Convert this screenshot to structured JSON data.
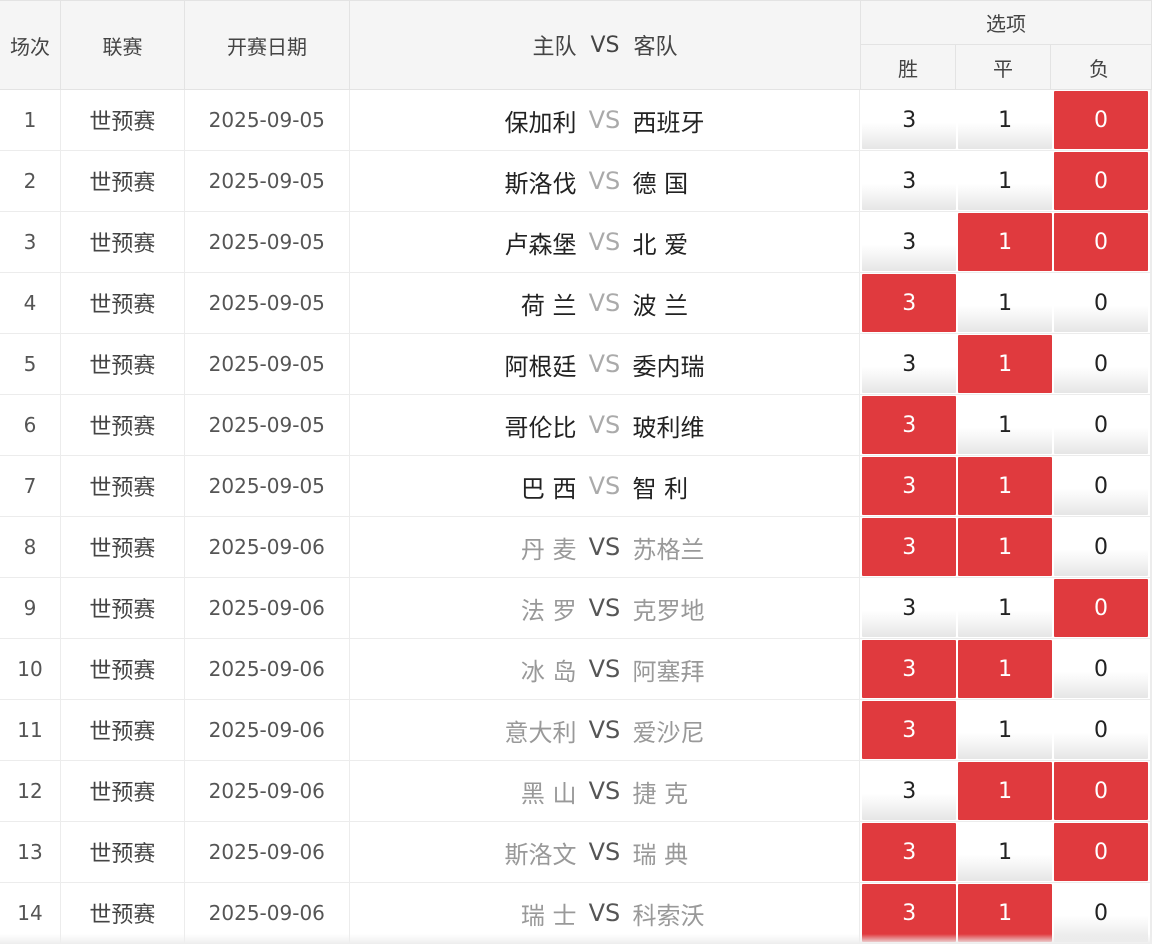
{
  "header": {
    "num": "场次",
    "league": "联赛",
    "date": "开赛日期",
    "home": "主队",
    "vs": "VS",
    "away": "客队",
    "options": "选项",
    "win": "胜",
    "draw": "平",
    "lose": "负"
  },
  "colors": {
    "selected": "#e03a3e",
    "header_bg": "#f5f5f5"
  },
  "rows": [
    {
      "num": "1",
      "league": "世预赛",
      "date": "2025-09-05",
      "home": "保加利",
      "vs": "VS",
      "away": "西班牙",
      "w": "3",
      "d": "1",
      "l": "0",
      "sel": [
        false,
        false,
        true
      ],
      "active": true
    },
    {
      "num": "2",
      "league": "世预赛",
      "date": "2025-09-05",
      "home": "斯洛伐",
      "vs": "VS",
      "away": "德 国",
      "w": "3",
      "d": "1",
      "l": "0",
      "sel": [
        false,
        false,
        true
      ],
      "active": true
    },
    {
      "num": "3",
      "league": "世预赛",
      "date": "2025-09-05",
      "home": "卢森堡",
      "vs": "VS",
      "away": "北 爱",
      "w": "3",
      "d": "1",
      "l": "0",
      "sel": [
        false,
        true,
        true
      ],
      "active": true
    },
    {
      "num": "4",
      "league": "世预赛",
      "date": "2025-09-05",
      "home": "荷 兰",
      "vs": "VS",
      "away": "波 兰",
      "w": "3",
      "d": "1",
      "l": "0",
      "sel": [
        true,
        false,
        false
      ],
      "active": true
    },
    {
      "num": "5",
      "league": "世预赛",
      "date": "2025-09-05",
      "home": "阿根廷",
      "vs": "VS",
      "away": "委内瑞",
      "w": "3",
      "d": "1",
      "l": "0",
      "sel": [
        false,
        true,
        false
      ],
      "active": true
    },
    {
      "num": "6",
      "league": "世预赛",
      "date": "2025-09-05",
      "home": "哥伦比",
      "vs": "VS",
      "away": "玻利维",
      "w": "3",
      "d": "1",
      "l": "0",
      "sel": [
        true,
        false,
        false
      ],
      "active": true
    },
    {
      "num": "7",
      "league": "世预赛",
      "date": "2025-09-05",
      "home": "巴 西",
      "vs": "VS",
      "away": "智 利",
      "w": "3",
      "d": "1",
      "l": "0",
      "sel": [
        true,
        true,
        false
      ],
      "active": true
    },
    {
      "num": "8",
      "league": "世预赛",
      "date": "2025-09-06",
      "home": "丹 麦",
      "vs": "VS",
      "away": "苏格兰",
      "w": "3",
      "d": "1",
      "l": "0",
      "sel": [
        true,
        true,
        false
      ],
      "active": false
    },
    {
      "num": "9",
      "league": "世预赛",
      "date": "2025-09-06",
      "home": "法 罗",
      "vs": "VS",
      "away": "克罗地",
      "w": "3",
      "d": "1",
      "l": "0",
      "sel": [
        false,
        false,
        true
      ],
      "active": false
    },
    {
      "num": "10",
      "league": "世预赛",
      "date": "2025-09-06",
      "home": "冰 岛",
      "vs": "VS",
      "away": "阿塞拜",
      "w": "3",
      "d": "1",
      "l": "0",
      "sel": [
        true,
        true,
        false
      ],
      "active": false
    },
    {
      "num": "11",
      "league": "世预赛",
      "date": "2025-09-06",
      "home": "意大利",
      "vs": "VS",
      "away": "爱沙尼",
      "w": "3",
      "d": "1",
      "l": "0",
      "sel": [
        true,
        false,
        false
      ],
      "active": false
    },
    {
      "num": "12",
      "league": "世预赛",
      "date": "2025-09-06",
      "home": "黑 山",
      "vs": "VS",
      "away": "捷 克",
      "w": "3",
      "d": "1",
      "l": "0",
      "sel": [
        false,
        true,
        true
      ],
      "active": false
    },
    {
      "num": "13",
      "league": "世预赛",
      "date": "2025-09-06",
      "home": "斯洛文",
      "vs": "VS",
      "away": "瑞 典",
      "w": "3",
      "d": "1",
      "l": "0",
      "sel": [
        true,
        false,
        true
      ],
      "active": false
    },
    {
      "num": "14",
      "league": "世预赛",
      "date": "2025-09-06",
      "home": "瑞 士",
      "vs": "VS",
      "away": "科索沃",
      "w": "3",
      "d": "1",
      "l": "0",
      "sel": [
        true,
        true,
        false
      ],
      "active": false
    }
  ]
}
